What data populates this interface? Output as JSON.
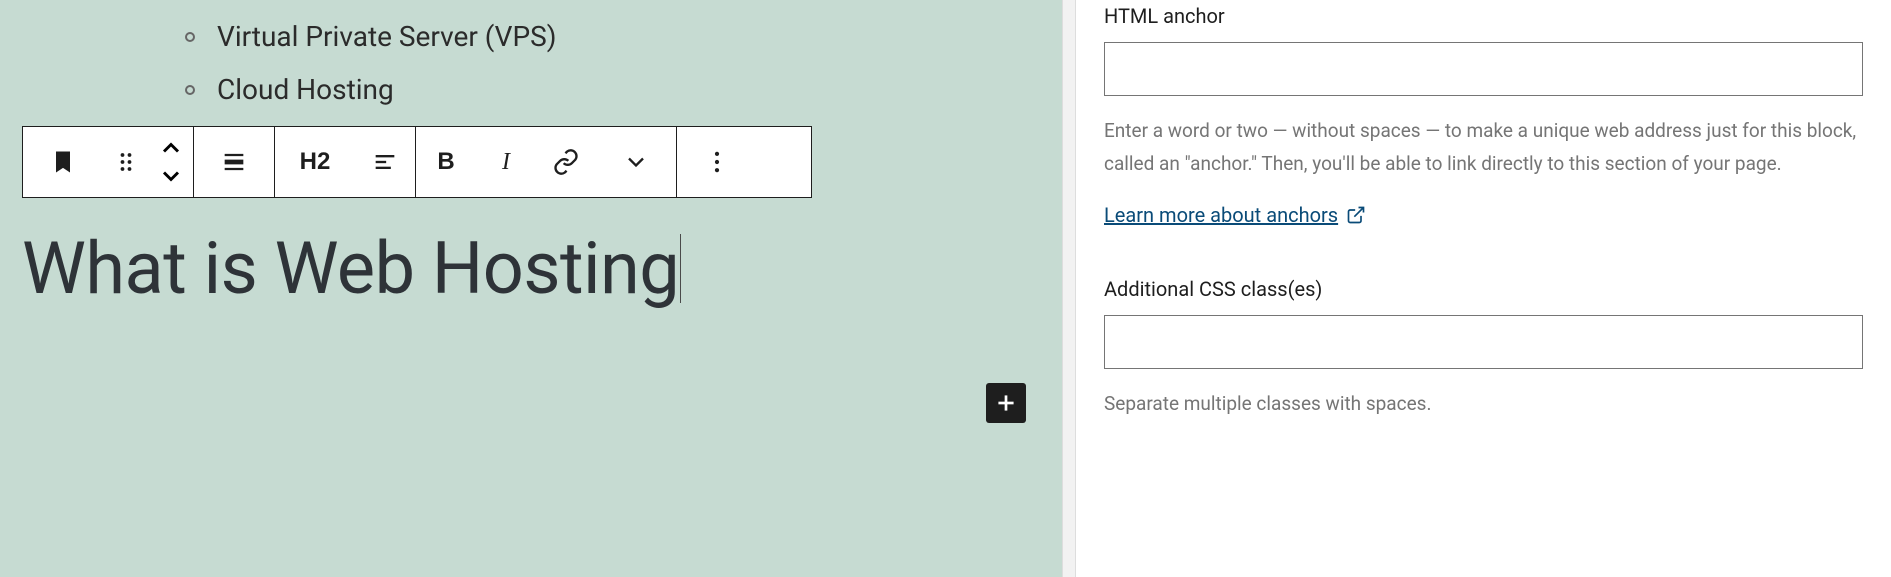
{
  "editor": {
    "list_items": [
      "Virtual Private Server (VPS)",
      "Cloud Hosting"
    ],
    "heading_text": "What is Web Hosting",
    "toolbar": {
      "heading_level": "H2"
    }
  },
  "sidebar": {
    "anchor": {
      "label": "HTML anchor",
      "value": "",
      "help": "Enter a word or two — without spaces — to make a unique web address just for this block, called an \"anchor.\" Then, you'll be able to link directly to this section of your page.",
      "link_label": "Learn more about anchors"
    },
    "css": {
      "label": "Additional CSS class(es)",
      "value": "",
      "help": "Separate multiple classes with spaces."
    }
  }
}
